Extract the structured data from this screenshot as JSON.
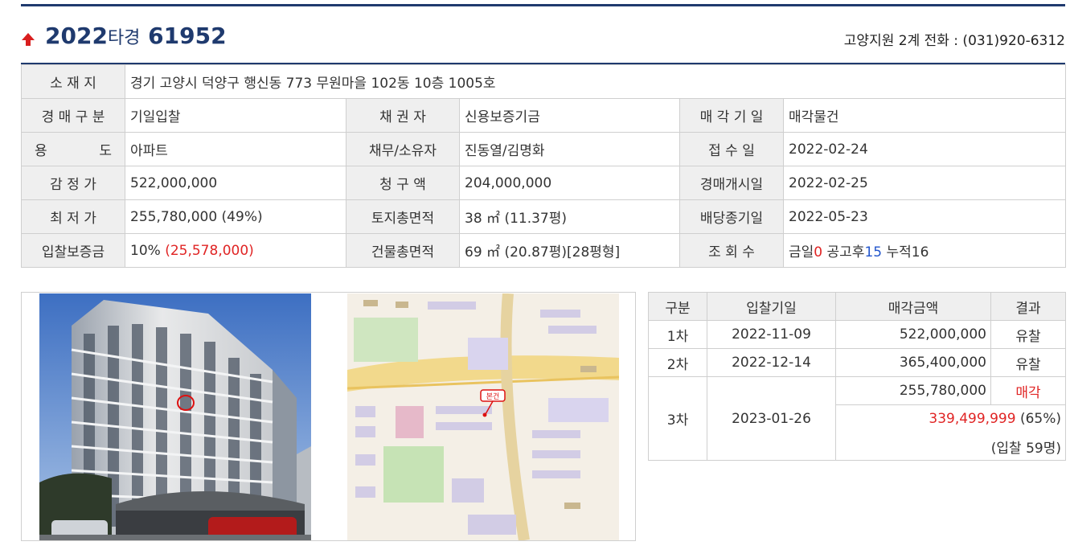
{
  "case": {
    "year": "2022",
    "type": "타경",
    "number": "61952",
    "court_info": "고양지원 2계 전화 : (031)920-6312"
  },
  "info": {
    "location_label": "소 재 지",
    "location": "경기 고양시 덕양구 행신동 773 무원마을 102동 10층 1005호",
    "auction_type_label": "경 매 구 분",
    "auction_type": "기일입찰",
    "creditor_label": "채 권 자",
    "creditor": "신용보증기금",
    "sale_date_label": "매 각 기 일",
    "sale_date": "매각물건",
    "use_label": "용 도",
    "use": "아파트",
    "debtor_label": "채무/소유자",
    "debtor": "진동열/김명화",
    "receipt_label": "접 수 일",
    "receipt": "2022-02-24",
    "appraisal_label": "감 정 가",
    "appraisal": "522,000,000",
    "claim_label": "청 구 액",
    "claim": "204,000,000",
    "start_label": "경매개시일",
    "start": "2022-02-25",
    "minimum_label": "최 저 가",
    "minimum": "255,780,000 (49%)",
    "land_area_label": "토지총면적",
    "land_area": "38 ㎡ (11.37평)",
    "dividend_label": "배당종기일",
    "dividend": "2022-05-23",
    "deposit_label": "입찰보증금",
    "deposit_pct": "10%",
    "deposit_amount": "(25,578,000)",
    "building_area_label": "건물총면적",
    "building_area": "69 ㎡ (20.87평)[28평형]",
    "views_label": "조 회 수",
    "views_today_label": "금일",
    "views_today": "0",
    "views_after_label": "공고후",
    "views_after": "15",
    "views_total_label": "누적",
    "views_total": "16"
  },
  "map": {
    "pin_label": "본건"
  },
  "history": {
    "headers": [
      "구분",
      "입찰기일",
      "매각금액",
      "결과"
    ],
    "rows": [
      {
        "round": "1차",
        "date": "2022-11-09",
        "amount": "522,000,000",
        "result": "유찰"
      },
      {
        "round": "2차",
        "date": "2022-12-14",
        "amount": "365,400,000",
        "result": "유찰"
      },
      {
        "round": "3차",
        "date": "2023-01-26",
        "amount": "255,780,000",
        "result": "매각",
        "winning_amount": "339,499,999",
        "winning_pct": "(65%)",
        "bidders": "(입찰 59명)"
      }
    ]
  }
}
